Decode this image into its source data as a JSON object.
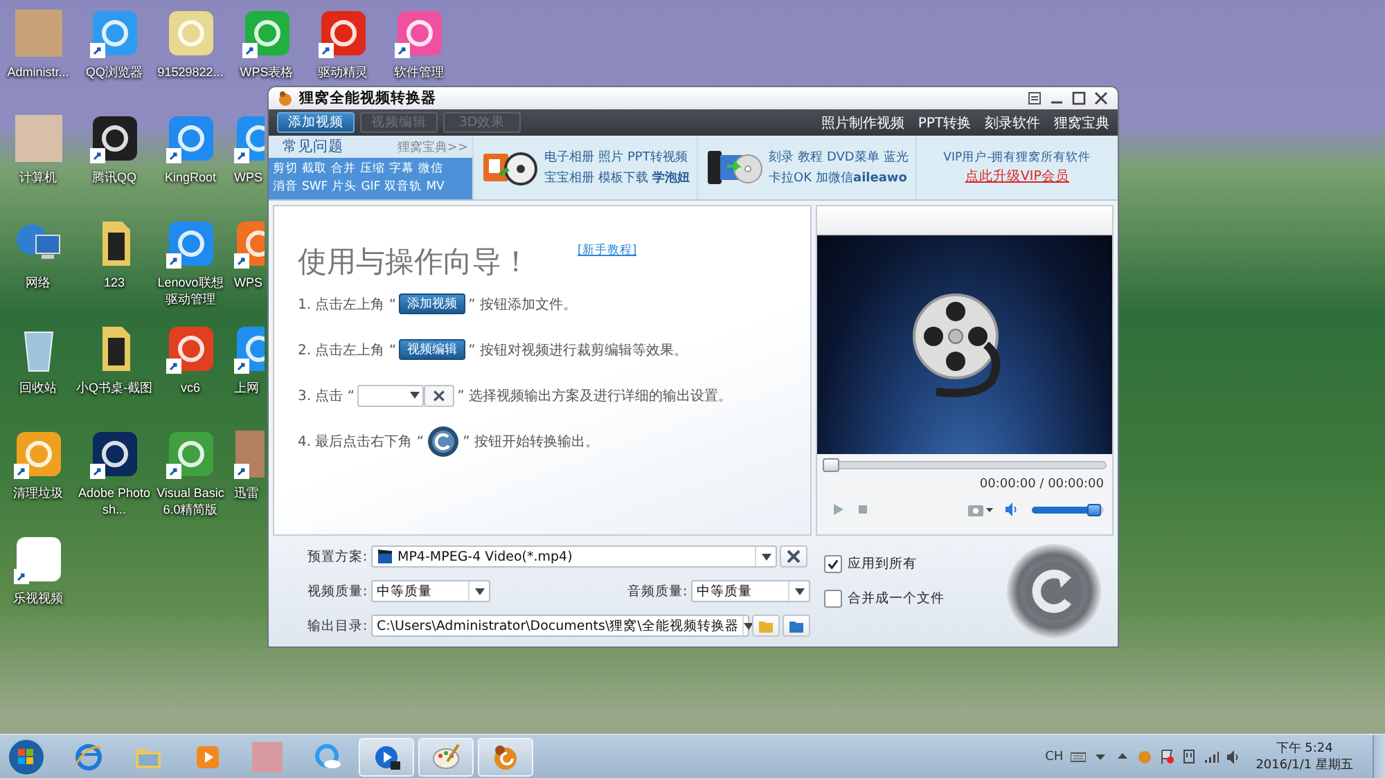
{
  "desktop": {
    "columns": [
      [
        {
          "label": "Administr...",
          "kind": "photo",
          "shortcut": false,
          "color": "#c9a27a"
        },
        {
          "label": "计算机",
          "kind": "photo",
          "shortcut": false,
          "color": "#d8c0a8"
        },
        {
          "label": "网络",
          "kind": "globe",
          "shortcut": false,
          "color": "#2f7fd0"
        },
        {
          "label": "回收站",
          "kind": "bin",
          "shortcut": false,
          "color": "#9fc4dc"
        },
        {
          "label": "清理垃圾",
          "kind": "app",
          "shortcut": true,
          "color": "#f0a020"
        },
        {
          "label": "乐视视频",
          "kind": "app",
          "shortcut": true,
          "color": "#ffffff"
        }
      ],
      [
        {
          "label": "QQ浏览器",
          "kind": "app",
          "shortcut": true,
          "color": "#2d9cf0"
        },
        {
          "label": "腾讯QQ",
          "kind": "app",
          "shortcut": true,
          "color": "#202020"
        },
        {
          "label": "123",
          "kind": "folder",
          "shortcut": false,
          "color": "#e8c860"
        },
        {
          "label": "小Q书桌-截图",
          "kind": "folder",
          "shortcut": false,
          "color": "#e8c860"
        },
        {
          "label": "Adobe Photosh...",
          "kind": "app",
          "shortcut": true,
          "color": "#0b2a5e"
        }
      ],
      [
        {
          "label": "91529822...",
          "kind": "app",
          "shortcut": false,
          "color": "#e8d890"
        },
        {
          "label": "KingRoot",
          "kind": "app",
          "shortcut": true,
          "color": "#1f8af0"
        },
        {
          "label": "Lenovo联想驱动管理",
          "kind": "app",
          "shortcut": true,
          "color": "#1f8af0"
        },
        {
          "label": "vc6",
          "kind": "app",
          "shortcut": true,
          "color": "#e04020"
        },
        {
          "label": "Visual Basic 6.0精简版",
          "kind": "app",
          "shortcut": true,
          "color": "#40a040"
        }
      ],
      [
        {
          "label": "WPS表格",
          "kind": "app",
          "shortcut": true,
          "color": "#20b040"
        },
        {
          "label": "WPS",
          "kind": "app",
          "shortcut": true,
          "color": "#2090f0"
        },
        {
          "label": "WPS",
          "kind": "app",
          "shortcut": true,
          "color": "#f07020"
        },
        {
          "label": "上网",
          "kind": "app",
          "shortcut": true,
          "color": "#2090f0"
        },
        {
          "label": "迅雷",
          "kind": "photo",
          "shortcut": true,
          "color": "#b08060"
        }
      ],
      [
        {
          "label": "驱动精灵",
          "kind": "app",
          "shortcut": true,
          "color": "#e02818"
        }
      ],
      [
        {
          "label": "软件管理",
          "kind": "app",
          "shortcut": true,
          "color": "#f050a0"
        }
      ]
    ]
  },
  "window": {
    "title": "狸窝全能视频转换器",
    "toolbar": {
      "buttons": [
        {
          "label": "添加视频",
          "disabled": false
        },
        {
          "label": "视频编辑",
          "disabled": true
        },
        {
          "label": "3D效果",
          "disabled": true
        }
      ],
      "links": [
        "照片制作视频",
        "PPT转换",
        "刻录软件",
        "狸窝宝典"
      ]
    },
    "promo": {
      "faq_title": "常见问题",
      "faq_more": "狸窝宝典>>",
      "faq_rows": [
        [
          "剪切",
          "截取",
          "合并",
          "压缩",
          "字幕",
          "微信"
        ],
        [
          "消音",
          "SWF",
          "片头",
          "GIF",
          "双音轨",
          "MV"
        ]
      ],
      "sections": [
        {
          "rows": [
            [
              {
                "text": "电子相册",
                "bold": false
              },
              {
                "text": "照片",
                "bold": false
              },
              {
                "text": "PPT转视频",
                "bold": false
              }
            ],
            [
              {
                "text": "宝宝相册",
                "bold": false
              },
              {
                "text": "模板下载",
                "bold": false
              },
              {
                "text": "学泡妞",
                "bold": true
              }
            ]
          ]
        },
        {
          "rows": [
            [
              {
                "text": "刻录",
                "bold": false
              },
              {
                "text": "教程",
                "bold": false
              },
              {
                "text": "DVD菜单",
                "bold": false
              },
              {
                "text": "蓝光",
                "bold": false
              }
            ],
            [
              {
                "text": "卡拉OK",
                "bold": false
              },
              {
                "text": "加微信**aileawo**",
                "bold": false
              }
            ]
          ]
        }
      ],
      "vip_text": "VIP用户-拥有狸窝所有软件",
      "vip_link": "点此升级VIP会员"
    },
    "guide": {
      "title": "使用与操作向导！",
      "tutorial_link": "[新手教程]",
      "steps": [
        {
          "kind": "button",
          "before": "1. 点击左上角 “",
          "label": "添加视频",
          "after": "” 按钮添加文件。"
        },
        {
          "kind": "button",
          "before": "2. 点击左上角 “",
          "label": "视频编辑",
          "after": "” 按钮对视频进行裁剪编辑等效果。"
        },
        {
          "kind": "dropdown",
          "before": "3. 点击 “",
          "after": "” 选择视频输出方案及进行详细的输出设置。"
        },
        {
          "kind": "convert",
          "before": "4. 最后点击右下角 “",
          "after": "” 按钮开始转换输出。"
        }
      ]
    },
    "player": {
      "progress": {
        "level": 0
      },
      "time": "00:00:00 / 00:00:00",
      "volume": {
        "level": 0.95
      }
    },
    "settings": {
      "preset_label": "预置方案:",
      "preset": "MP4-MPEG-4 Video(*.mp4)",
      "video_quality_label": "视频质量:",
      "video_quality": "中等质量",
      "audio_quality_label": "音频质量:",
      "audio_quality": "中等质量",
      "output_label": "输出目录:",
      "output_path": "C:\\Users\\Administrator\\Documents\\狸窝\\全能视频转换器",
      "checkboxes": [
        {
          "label": "应用到所有",
          "checked": true
        },
        {
          "label": "合并成一个文件",
          "checked": false
        }
      ]
    }
  },
  "taskbar": {
    "apps": [
      {
        "kind": "ie",
        "active": false
      },
      {
        "kind": "folder",
        "active": false
      },
      {
        "kind": "media",
        "active": false
      },
      {
        "kind": "photo",
        "active": false
      },
      {
        "kind": "browser",
        "active": false
      },
      {
        "kind": "video",
        "active": true
      },
      {
        "kind": "paint",
        "active": true
      },
      {
        "kind": "converter",
        "active": true
      }
    ],
    "language": "CH",
    "time": "下午 5:24",
    "date": "2016/1/1 星期五"
  }
}
